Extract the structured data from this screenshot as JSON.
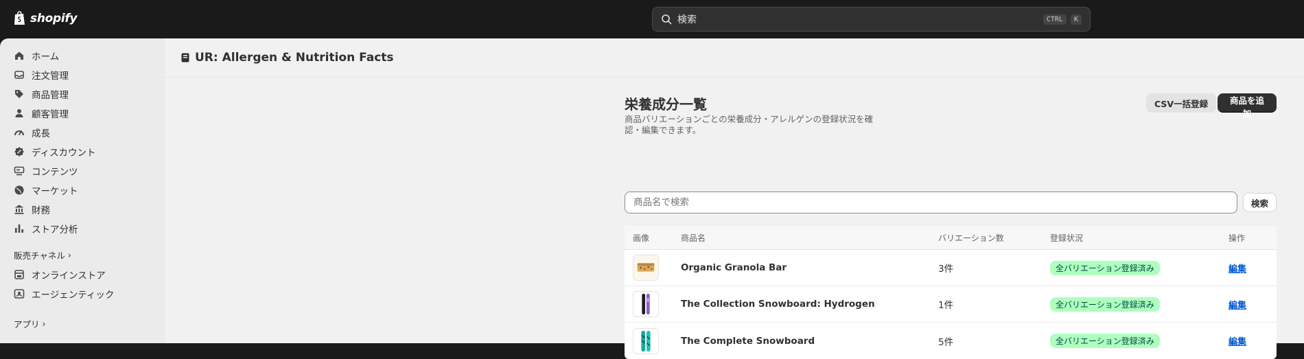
{
  "topbar": {
    "logo_text": "shopify",
    "search_placeholder": "検索",
    "shortcut_keys": [
      "CTRL",
      "K"
    ]
  },
  "sidebar": {
    "items": [
      {
        "label": "ホーム",
        "icon": "home-icon"
      },
      {
        "label": "注文管理",
        "icon": "inbox-icon"
      },
      {
        "label": "商品管理",
        "icon": "tag-icon"
      },
      {
        "label": "顧客管理",
        "icon": "person-icon"
      },
      {
        "label": "成長",
        "icon": "gauge-icon"
      },
      {
        "label": "ディスカウント",
        "icon": "discount-icon"
      },
      {
        "label": "コンテンツ",
        "icon": "content-icon"
      },
      {
        "label": "マーケット",
        "icon": "globe-icon"
      },
      {
        "label": "財務",
        "icon": "bank-icon"
      },
      {
        "label": "ストア分析",
        "icon": "bar-chart-icon"
      }
    ],
    "sales_channels_label": "販売チャネル",
    "channels": [
      {
        "label": "オンラインストア",
        "icon": "store-icon"
      },
      {
        "label": "エージェンティック",
        "icon": "agent-icon"
      }
    ],
    "apps_label": "アプリ"
  },
  "app_header": {
    "title": "UR: Allergen & Nutrition Facts"
  },
  "page": {
    "title": "栄養成分一覧",
    "description": "商品バリエーションごとの栄養成分・アレルゲンの登録状況を確認・編集できます。",
    "csv_button": "CSV一括登録",
    "add_button": "商品を追加",
    "filter_placeholder": "商品名で検索",
    "filter_button": "検索"
  },
  "table": {
    "columns": [
      "画像",
      "商品名",
      "バリエーション数",
      "登録状況",
      "操作"
    ],
    "rows": [
      {
        "name": "Organic Granola Bar",
        "variants": "3件",
        "status": "全バリエーション登録済み",
        "action": "編集",
        "thumb": "granola"
      },
      {
        "name": "The Collection Snowboard: Hydrogen",
        "variants": "1件",
        "status": "全バリエーション登録済み",
        "action": "編集",
        "thumb": "snowboard-hydrogen"
      },
      {
        "name": "The Complete Snowboard",
        "variants": "5件",
        "status": "全バリエーション登録済み",
        "action": "編集",
        "thumb": "snowboard-complete"
      }
    ]
  },
  "colors": {
    "topbar_bg": "#1a1a1a",
    "sidebar_bg": "#ebebeb",
    "main_bg": "#f1f1f1",
    "badge_bg": "#affebf",
    "badge_text": "#014b40",
    "link": "#005bd3",
    "primary_button": "#303030"
  }
}
